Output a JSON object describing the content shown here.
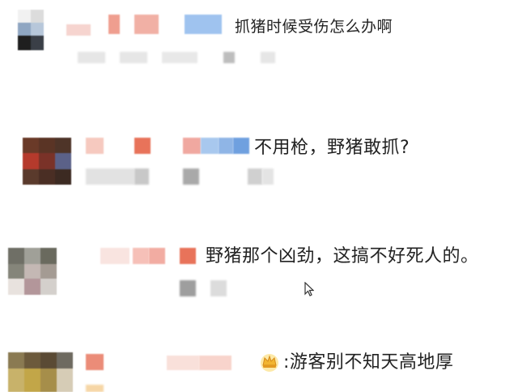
{
  "comments": [
    {
      "text": "抓猪时候受伤怎么办啊"
    },
    {
      "text": "不用枪，野猪敢抓?"
    },
    {
      "text": "野猪那个凶劲，这搞不好死人的。"
    },
    {
      "text": ":游客别不知天高地厚"
    }
  ],
  "icons": {
    "cursor": "mouse-cursor-icon",
    "badge": "crown-badge-icon"
  },
  "colors": {
    "accent_orange": "#e8735a",
    "blur_pink": "#f4c2b8",
    "blur_blue": "#a8c8ee",
    "blur_gray": "#d4d4d4"
  }
}
